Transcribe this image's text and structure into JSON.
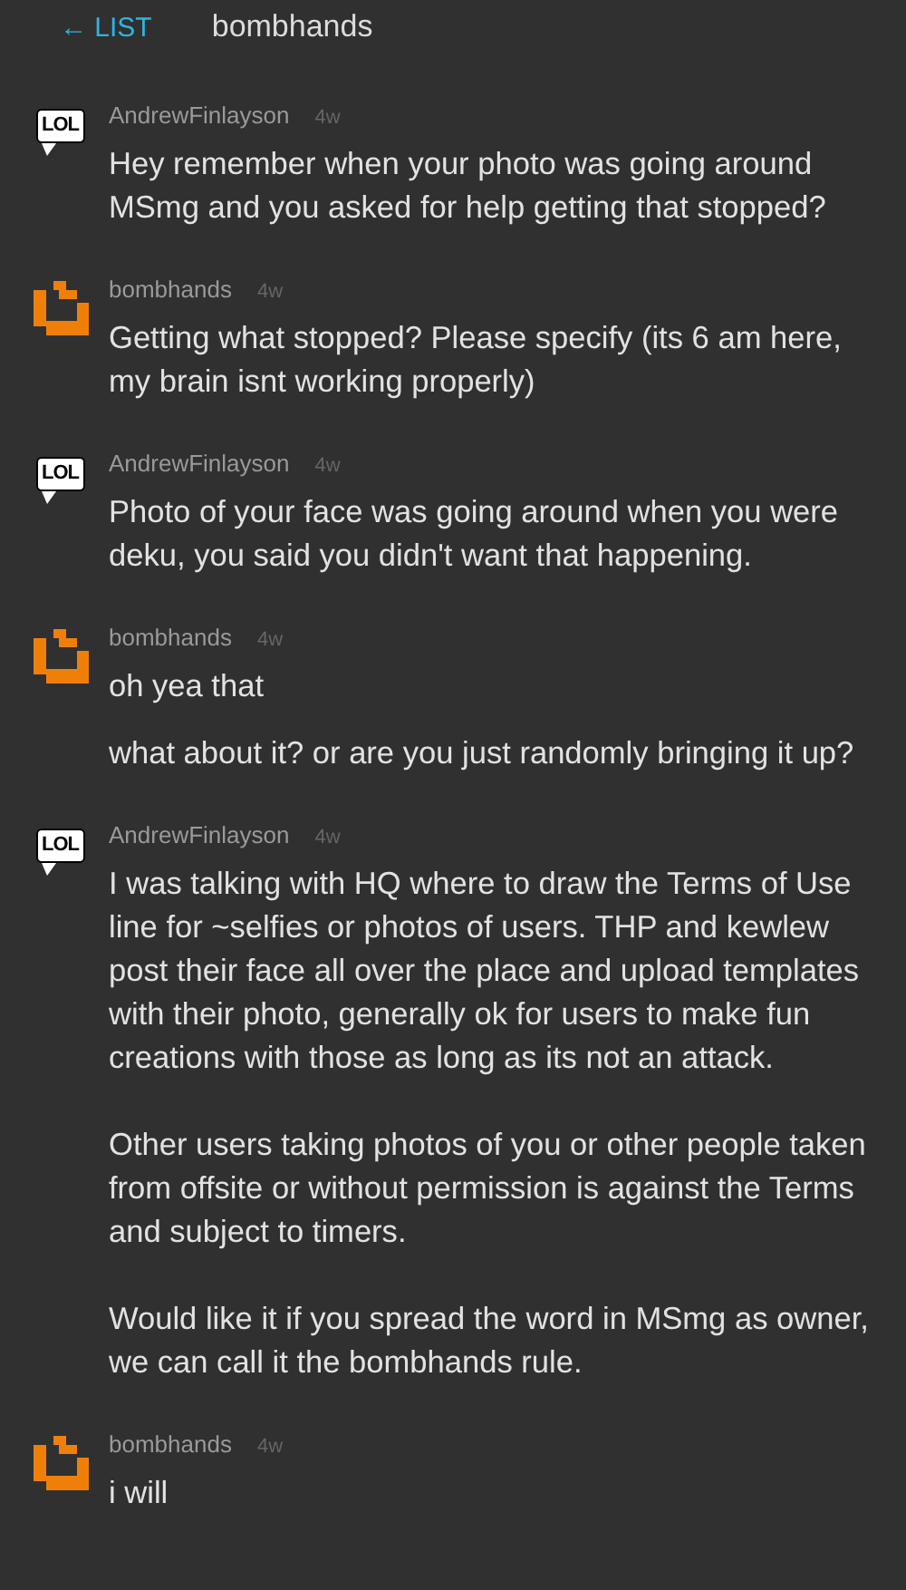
{
  "header": {
    "back_label": "← LIST",
    "title": "bombhands"
  },
  "messages": [
    {
      "author": "AndrewFinlayson",
      "time": "4w",
      "avatar": {
        "kind": "speech",
        "text": "LOL"
      },
      "paragraphs": [
        "Hey remember when your photo was going around MSmg and you asked for help getting that stopped?"
      ]
    },
    {
      "author": "bombhands",
      "time": "4w",
      "avatar": {
        "kind": "pixel"
      },
      "paragraphs": [
        "Getting what stopped? Please specify (its 6 am here, my brain isnt working properly)"
      ]
    },
    {
      "author": "AndrewFinlayson",
      "time": "4w",
      "avatar": {
        "kind": "speech",
        "text": "LOL"
      },
      "paragraphs": [
        "Photo of your face was going around when you were deku, you said you didn't want that happening."
      ]
    },
    {
      "author": "bombhands",
      "time": "4w",
      "avatar": {
        "kind": "pixel"
      },
      "paragraphs": [
        "oh yea that",
        "what about it? or are you just randomly bringing it up?"
      ]
    },
    {
      "author": "AndrewFinlayson",
      "time": "4w",
      "avatar": {
        "kind": "speech",
        "text": "LOL"
      },
      "paragraphs": [
        "I was talking with HQ where to draw the Terms of Use line for ~selfies or photos of users. THP and kewlew post their face all over the place and upload templates with their photo, generally ok for users to make fun creations with those as long as its not an attack.\n\nOther users taking photos of you or other people taken from offsite or without permission is against the Terms and subject to timers.\n\nWould like it if you spread the word in MSmg as owner, we can call it the bombhands rule."
      ]
    },
    {
      "author": "bombhands",
      "time": "4w",
      "avatar": {
        "kind": "pixel"
      },
      "paragraphs": [
        "i will"
      ]
    }
  ]
}
